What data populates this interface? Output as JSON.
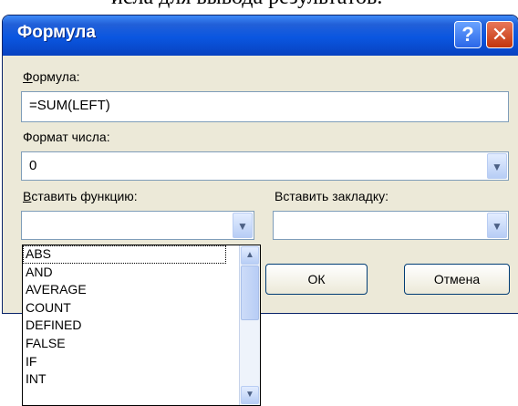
{
  "background_text": "исла для вывода результатов.",
  "dialog": {
    "title": "Формула",
    "help_label": "?",
    "close_label": "✕",
    "formula_label": "Формула:",
    "formula_value": "=SUM(LEFT)",
    "number_format_label": "Формат числа:",
    "number_format_value": "0",
    "insert_function_label": "Вставить функцию:",
    "insert_function_value": "",
    "insert_bookmark_label": "Вставить закладку:",
    "insert_bookmark_value": "",
    "ok_label": "ОК",
    "cancel_label": "Отмена"
  },
  "function_list": {
    "items": [
      "ABS",
      "AND",
      "AVERAGE",
      "COUNT",
      "DEFINED",
      "FALSE",
      "IF",
      "INT"
    ],
    "selected": "ABS"
  },
  "icons": {
    "dropdown": "chevron-down-icon",
    "scroll_up": "arrow-up-icon",
    "scroll_down": "arrow-down-icon"
  },
  "colors": {
    "titlebar": "#0a56e0",
    "dialog_bg": "#ece9d8",
    "close": "#c2350c",
    "help": "#2a67e8"
  }
}
